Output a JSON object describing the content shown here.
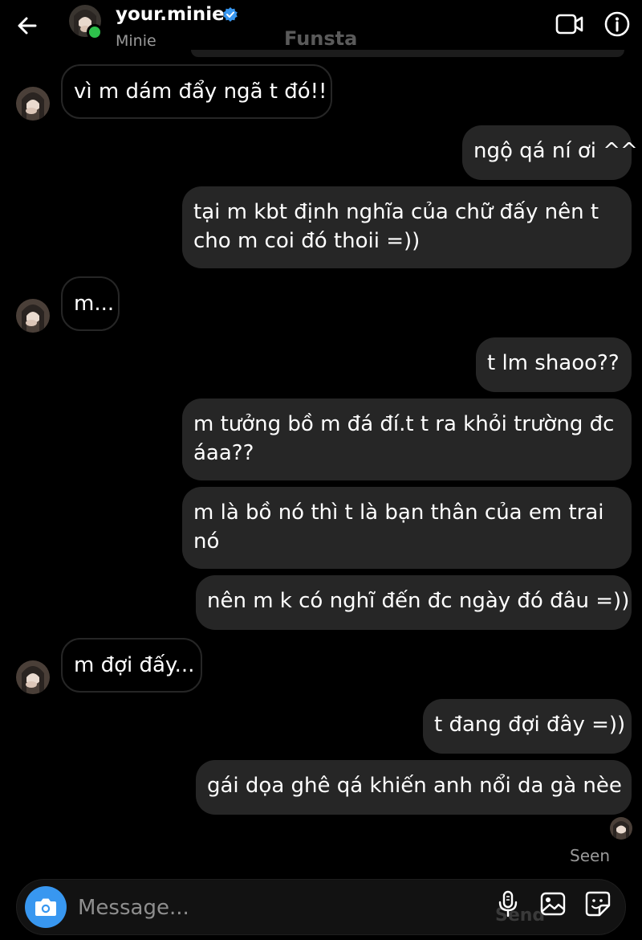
{
  "header": {
    "name": "your.minie",
    "subtitle": "Minie",
    "ghost_title": "Funsta"
  },
  "messages": [
    {
      "side": "them",
      "text": "vì m dám đẩy ngã t đó!!"
    },
    {
      "side": "me",
      "text": "ngộ qá ní ơi ^^"
    },
    {
      "side": "me",
      "text": "tại m kbt định nghĩa của chữ đấy nên t cho m coi đó thoii =))"
    },
    {
      "side": "them",
      "text": "m..."
    },
    {
      "side": "me",
      "text": "t lm shaoo??"
    },
    {
      "side": "me",
      "text": "m tưởng bồ m đá đí.t t ra khỏi trường đc áaa??"
    },
    {
      "side": "me",
      "text": "m là bồ nó thì t là bạn thân của em trai nó"
    },
    {
      "side": "me",
      "text": "nên m k có nghĩ đến đc ngày đó đâu =))"
    },
    {
      "side": "them",
      "text": "m đợi đấy..."
    },
    {
      "side": "me",
      "text": "t đang đợi đây =))"
    },
    {
      "side": "me",
      "text": "gái dọa ghê qá khiến anh nổi da gà nèe"
    }
  ],
  "status": {
    "seen": "Seen"
  },
  "composer": {
    "placeholder": "Message...",
    "ghost_send": "Send"
  },
  "icons": {
    "back": "arrow-left-icon",
    "verified": "verified-badge-icon",
    "video": "video-camera-icon",
    "info": "info-icon",
    "camera": "camera-icon",
    "mic": "microphone-icon",
    "gallery": "image-gallery-icon",
    "sticker": "sticker-icon"
  },
  "colors": {
    "background": "#000000",
    "bubble_me": "#262626",
    "bubble_them_border": "#262626",
    "accent_blue": "#3897f0",
    "online_green": "#2ec14c",
    "muted_text": "#9a9a9a"
  }
}
